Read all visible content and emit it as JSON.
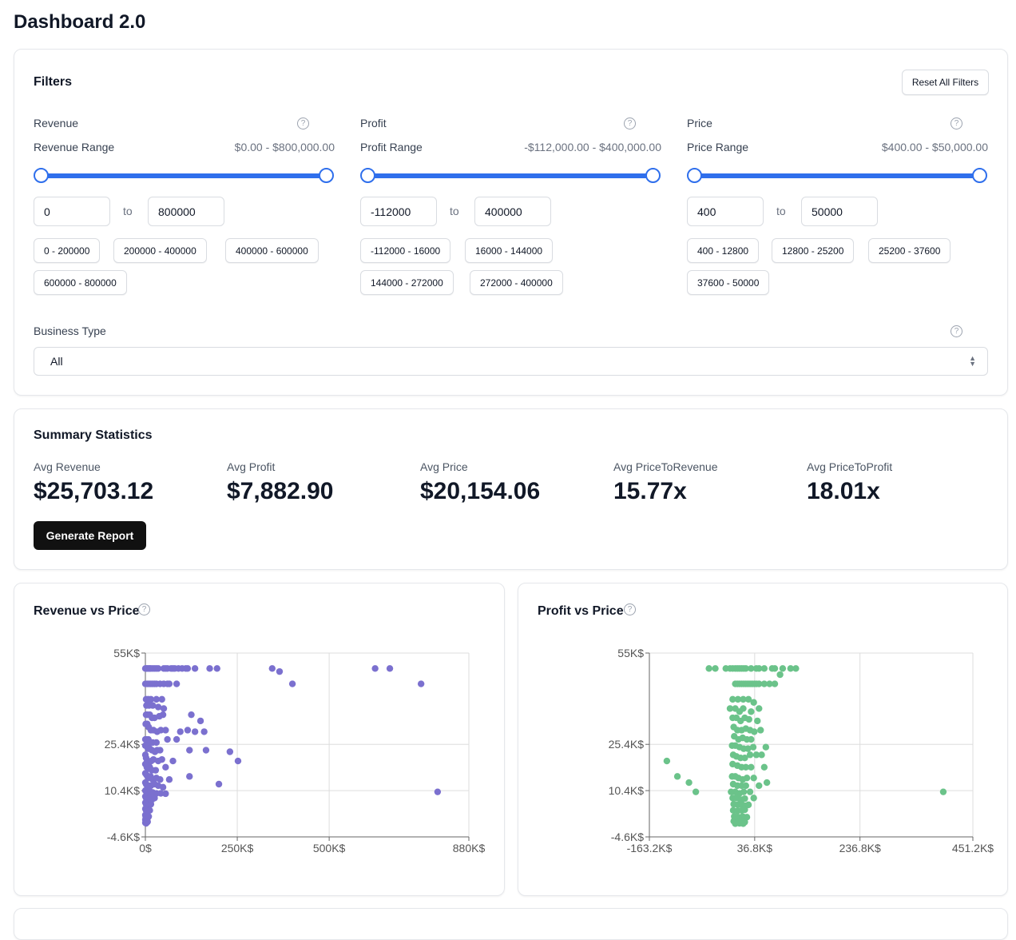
{
  "page": {
    "title": "Dashboard 2.0"
  },
  "filters": {
    "title": "Filters",
    "reset_label": "Reset All Filters",
    "help_glyph": "?",
    "to_label": "to",
    "revenue": {
      "label": "Revenue",
      "range_label": "Revenue Range",
      "range_value": "$0.00 - $800,000.00",
      "min": "0",
      "max": "800000",
      "presets": [
        "0 - 200000",
        "200000 - 400000",
        "400000 - 600000",
        "600000 - 800000"
      ]
    },
    "profit": {
      "label": "Profit",
      "range_label": "Profit Range",
      "range_value": "-$112,000.00 - $400,000.00",
      "min": "-112000",
      "max": "400000",
      "presets": [
        "-112000 - 16000",
        "16000 - 144000",
        "144000 - 272000",
        "272000 - 400000"
      ]
    },
    "price": {
      "label": "Price",
      "range_label": "Price Range",
      "range_value": "$400.00 - $50,000.00",
      "min": "400",
      "max": "50000",
      "presets": [
        "400 - 12800",
        "12800 - 25200",
        "25200 - 37600",
        "37600 - 50000"
      ]
    },
    "business_type": {
      "label": "Business Type",
      "selected": "All"
    }
  },
  "summary": {
    "title": "Summary Statistics",
    "stats": [
      {
        "label": "Avg Revenue",
        "value": "$25,703.12"
      },
      {
        "label": "Avg Profit",
        "value": "$7,882.90"
      },
      {
        "label": "Avg Price",
        "value": "$20,154.06"
      },
      {
        "label": "Avg PriceToRevenue",
        "value": "15.77x"
      },
      {
        "label": "Avg PriceToProfit",
        "value": "18.01x"
      }
    ],
    "report_button": "Generate Report"
  },
  "colors": {
    "accent": "#2f6fec",
    "revenue_points": "#7b70cf",
    "profit_points": "#6bc38a"
  },
  "chart_data": [
    {
      "type": "scatter",
      "title": "Revenue vs Price",
      "xlabel": "",
      "ylabel": "",
      "xlim": [
        0,
        880000
      ],
      "ylim": [
        -4600,
        55000
      ],
      "x_ticks": [
        0,
        250000,
        500000,
        880000
      ],
      "x_tick_labels": [
        "0$",
        "250K$",
        "500K$",
        "880K$"
      ],
      "y_ticks": [
        -4600,
        10400,
        25400,
        55000
      ],
      "y_tick_labels": [
        "-4.6K$",
        "10.4K$",
        "25.4K$",
        "55K$"
      ],
      "color": "#7b70cf",
      "points": [
        [
          0,
          50000
        ],
        [
          3000,
          50000
        ],
        [
          6000,
          50000
        ],
        [
          9000,
          50000
        ],
        [
          12000,
          50000
        ],
        [
          15000,
          50000
        ],
        [
          20000,
          50000
        ],
        [
          25000,
          50000
        ],
        [
          30000,
          50000
        ],
        [
          35000,
          50000
        ],
        [
          50000,
          50000
        ],
        [
          55000,
          50000
        ],
        [
          60000,
          50000
        ],
        [
          70000,
          50000
        ],
        [
          75000,
          50000
        ],
        [
          80000,
          50000
        ],
        [
          90000,
          50000
        ],
        [
          100000,
          50000
        ],
        [
          110000,
          50000
        ],
        [
          115000,
          50000
        ],
        [
          135000,
          50000
        ],
        [
          175000,
          50000
        ],
        [
          195000,
          50000
        ],
        [
          345000,
          50000
        ],
        [
          365000,
          49000
        ],
        [
          625000,
          50000
        ],
        [
          665000,
          50000
        ],
        [
          0,
          45000
        ],
        [
          5000,
          45000
        ],
        [
          10000,
          45000
        ],
        [
          15000,
          45000
        ],
        [
          20000,
          45000
        ],
        [
          25000,
          45000
        ],
        [
          30000,
          45000
        ],
        [
          40000,
          45000
        ],
        [
          50000,
          45000
        ],
        [
          60000,
          45000
        ],
        [
          65000,
          45000
        ],
        [
          85000,
          45000
        ],
        [
          400000,
          45000
        ],
        [
          750000,
          45000
        ],
        [
          2000,
          40000
        ],
        [
          8000,
          40000
        ],
        [
          15000,
          40000
        ],
        [
          30000,
          40000
        ],
        [
          45000,
          40000
        ],
        [
          3000,
          38000
        ],
        [
          10000,
          38000
        ],
        [
          20000,
          38000
        ],
        [
          35000,
          37500
        ],
        [
          50000,
          37000
        ],
        [
          2000,
          35000
        ],
        [
          6000,
          35000
        ],
        [
          12000,
          35000
        ],
        [
          18000,
          34000
        ],
        [
          25000,
          34000
        ],
        [
          38000,
          34500
        ],
        [
          48000,
          35000
        ],
        [
          125000,
          35000
        ],
        [
          150000,
          33000
        ],
        [
          1000,
          32000
        ],
        [
          5000,
          32000
        ],
        [
          9000,
          31000
        ],
        [
          15000,
          30000
        ],
        [
          22000,
          30000
        ],
        [
          32000,
          29500
        ],
        [
          42000,
          30000
        ],
        [
          55000,
          30000
        ],
        [
          95000,
          29500
        ],
        [
          115000,
          30000
        ],
        [
          135000,
          29500
        ],
        [
          160000,
          29500
        ],
        [
          0,
          27000
        ],
        [
          4000,
          27000
        ],
        [
          8000,
          27000
        ],
        [
          14000,
          26000
        ],
        [
          20000,
          26000
        ],
        [
          30000,
          26000
        ],
        [
          60000,
          27000
        ],
        [
          85000,
          27000
        ],
        [
          0,
          25000
        ],
        [
          3000,
          25000
        ],
        [
          7000,
          24000
        ],
        [
          12000,
          24000
        ],
        [
          18000,
          23500
        ],
        [
          26000,
          23000
        ],
        [
          32000,
          23500
        ],
        [
          40000,
          23500
        ],
        [
          120000,
          23500
        ],
        [
          165000,
          23500
        ],
        [
          230000,
          23000
        ],
        [
          252000,
          20000
        ],
        [
          0,
          22000
        ],
        [
          2000,
          21000
        ],
        [
          5000,
          20000
        ],
        [
          10000,
          19500
        ],
        [
          16000,
          20000
        ],
        [
          22000,
          20500
        ],
        [
          35000,
          20000
        ],
        [
          45000,
          20500
        ],
        [
          75000,
          20000
        ],
        [
          0,
          19000
        ],
        [
          4000,
          18000
        ],
        [
          8000,
          17500
        ],
        [
          12000,
          18000
        ],
        [
          18000,
          17000
        ],
        [
          28000,
          17000
        ],
        [
          55000,
          18000
        ],
        [
          0,
          16000
        ],
        [
          3000,
          15500
        ],
        [
          6000,
          15000
        ],
        [
          10000,
          14500
        ],
        [
          14000,
          15000
        ],
        [
          20000,
          14000
        ],
        [
          30000,
          14500
        ],
        [
          40000,
          14000
        ],
        [
          65000,
          14000
        ],
        [
          120000,
          15000
        ],
        [
          200000,
          12500
        ],
        [
          0,
          13000
        ],
        [
          2000,
          12500
        ],
        [
          5000,
          12000
        ],
        [
          9000,
          12000
        ],
        [
          15000,
          12000
        ],
        [
          25000,
          12500
        ],
        [
          35000,
          12000
        ],
        [
          48000,
          11500
        ],
        [
          0,
          10400
        ],
        [
          3000,
          10000
        ],
        [
          6000,
          10000
        ],
        [
          10000,
          10000
        ],
        [
          14000,
          10000
        ],
        [
          20000,
          9800
        ],
        [
          30000,
          9500
        ],
        [
          42000,
          9500
        ],
        [
          55000,
          9400
        ],
        [
          795000,
          10000
        ],
        [
          0,
          8500
        ],
        [
          2000,
          8000
        ],
        [
          5000,
          8000
        ],
        [
          8000,
          7800
        ],
        [
          12000,
          8000
        ],
        [
          18000,
          7500
        ],
        [
          25000,
          8000
        ],
        [
          0,
          6500
        ],
        [
          2000,
          6000
        ],
        [
          4000,
          6000
        ],
        [
          7000,
          5800
        ],
        [
          10000,
          5500
        ],
        [
          15000,
          6000
        ],
        [
          0,
          4500
        ],
        [
          2000,
          4000
        ],
        [
          5000,
          4000
        ],
        [
          8000,
          3800
        ],
        [
          12000,
          4000
        ],
        [
          0,
          2500
        ],
        [
          1000,
          2000
        ],
        [
          3000,
          2000
        ],
        [
          6000,
          1500
        ],
        [
          9000,
          2000
        ],
        [
          0,
          1000
        ],
        [
          2000,
          600
        ],
        [
          4000,
          800
        ],
        [
          6000,
          300
        ],
        [
          0,
          0
        ],
        [
          2000,
          -200
        ],
        [
          5000,
          200
        ]
      ]
    },
    {
      "type": "scatter",
      "title": "Profit vs Price",
      "xlabel": "",
      "ylabel": "",
      "xlim": [
        -163200,
        451200
      ],
      "ylim": [
        -4600,
        55000
      ],
      "x_ticks": [
        -163200,
        36800,
        236800,
        451200
      ],
      "x_tick_labels": [
        "-163.2K$",
        "36.8K$",
        "236.8K$",
        "451.2K$"
      ],
      "y_ticks": [
        -4600,
        10400,
        25400,
        55000
      ],
      "y_tick_labels": [
        "-4.6K$",
        "10.4K$",
        "25.4K$",
        "55K$"
      ],
      "color": "#6bc38a",
      "points": [
        [
          -50000,
          50000
        ],
        [
          -38000,
          50000
        ],
        [
          -18000,
          50000
        ],
        [
          -10000,
          50000
        ],
        [
          -5000,
          50000
        ],
        [
          0,
          50000
        ],
        [
          4000,
          50000
        ],
        [
          8000,
          50000
        ],
        [
          12000,
          50000
        ],
        [
          16000,
          50000
        ],
        [
          20000,
          50000
        ],
        [
          30000,
          50000
        ],
        [
          40000,
          50000
        ],
        [
          45000,
          50000
        ],
        [
          55000,
          50000
        ],
        [
          70000,
          50000
        ],
        [
          75000,
          50000
        ],
        [
          85000,
          48000
        ],
        [
          90000,
          50000
        ],
        [
          105000,
          50000
        ],
        [
          115000,
          50000
        ],
        [
          0,
          45000
        ],
        [
          4000,
          45000
        ],
        [
          8000,
          45000
        ],
        [
          12000,
          45000
        ],
        [
          16000,
          45000
        ],
        [
          20000,
          45000
        ],
        [
          24000,
          45000
        ],
        [
          28000,
          45000
        ],
        [
          32000,
          45000
        ],
        [
          36000,
          45000
        ],
        [
          40000,
          45000
        ],
        [
          45000,
          45000
        ],
        [
          55000,
          45000
        ],
        [
          65000,
          45000
        ],
        [
          75000,
          45000
        ],
        [
          -5000,
          40000
        ],
        [
          5000,
          40000
        ],
        [
          15000,
          40000
        ],
        [
          25000,
          40000
        ],
        [
          35000,
          39000
        ],
        [
          -10000,
          37000
        ],
        [
          0,
          37000
        ],
        [
          8000,
          36000
        ],
        [
          15000,
          37000
        ],
        [
          30000,
          36000
        ],
        [
          45000,
          37000
        ],
        [
          -5000,
          34000
        ],
        [
          2000,
          34000
        ],
        [
          10000,
          33000
        ],
        [
          18000,
          34000
        ],
        [
          26000,
          33500
        ],
        [
          42000,
          33000
        ],
        [
          -3000,
          31000
        ],
        [
          4000,
          30000
        ],
        [
          12000,
          30000
        ],
        [
          20000,
          30500
        ],
        [
          28000,
          30000
        ],
        [
          36000,
          29500
        ],
        [
          48000,
          30000
        ],
        [
          -2000,
          28000
        ],
        [
          6000,
          27000
        ],
        [
          14000,
          27500
        ],
        [
          22000,
          27000
        ],
        [
          30000,
          27000
        ],
        [
          -6000,
          25000
        ],
        [
          0,
          25000
        ],
        [
          8000,
          24500
        ],
        [
          16000,
          24000
        ],
        [
          24000,
          24000
        ],
        [
          34000,
          24500
        ],
        [
          58000,
          24500
        ],
        [
          -4000,
          22000
        ],
        [
          2000,
          21500
        ],
        [
          10000,
          21000
        ],
        [
          18000,
          21000
        ],
        [
          28000,
          22000
        ],
        [
          40000,
          22000
        ],
        [
          50000,
          22000
        ],
        [
          -130000,
          20000
        ],
        [
          -5000,
          19000
        ],
        [
          4000,
          18500
        ],
        [
          12000,
          18000
        ],
        [
          20000,
          18000
        ],
        [
          30000,
          18000
        ],
        [
          55000,
          18000
        ],
        [
          -110000,
          15000
        ],
        [
          -6000,
          15000
        ],
        [
          0,
          15000
        ],
        [
          6000,
          14500
        ],
        [
          14000,
          14000
        ],
        [
          22000,
          14500
        ],
        [
          35000,
          14500
        ],
        [
          60000,
          13000
        ],
        [
          -88000,
          13000
        ],
        [
          -4000,
          12500
        ],
        [
          4000,
          12000
        ],
        [
          12000,
          12000
        ],
        [
          20000,
          12000
        ],
        [
          45000,
          12000
        ],
        [
          -75000,
          10000
        ],
        [
          -8000,
          10000
        ],
        [
          0,
          10000
        ],
        [
          8000,
          9500
        ],
        [
          16000,
          10000
        ],
        [
          28000,
          10000
        ],
        [
          395000,
          10000
        ],
        [
          -5000,
          8000
        ],
        [
          2000,
          8000
        ],
        [
          10000,
          7500
        ],
        [
          18000,
          7800
        ],
        [
          35000,
          8000
        ],
        [
          -3000,
          6000
        ],
        [
          5000,
          5800
        ],
        [
          12000,
          6000
        ],
        [
          20000,
          5500
        ],
        [
          25000,
          5800
        ],
        [
          -4000,
          4000
        ],
        [
          4000,
          3800
        ],
        [
          12000,
          4000
        ],
        [
          18000,
          4200
        ],
        [
          -2000,
          2000
        ],
        [
          6000,
          1800
        ],
        [
          14000,
          2000
        ],
        [
          22000,
          1800
        ],
        [
          -3000,
          500
        ],
        [
          5000,
          300
        ],
        [
          12000,
          600
        ],
        [
          18000,
          200
        ],
        [
          0,
          -300
        ],
        [
          8000,
          -200
        ],
        [
          15000,
          -300
        ]
      ]
    }
  ]
}
